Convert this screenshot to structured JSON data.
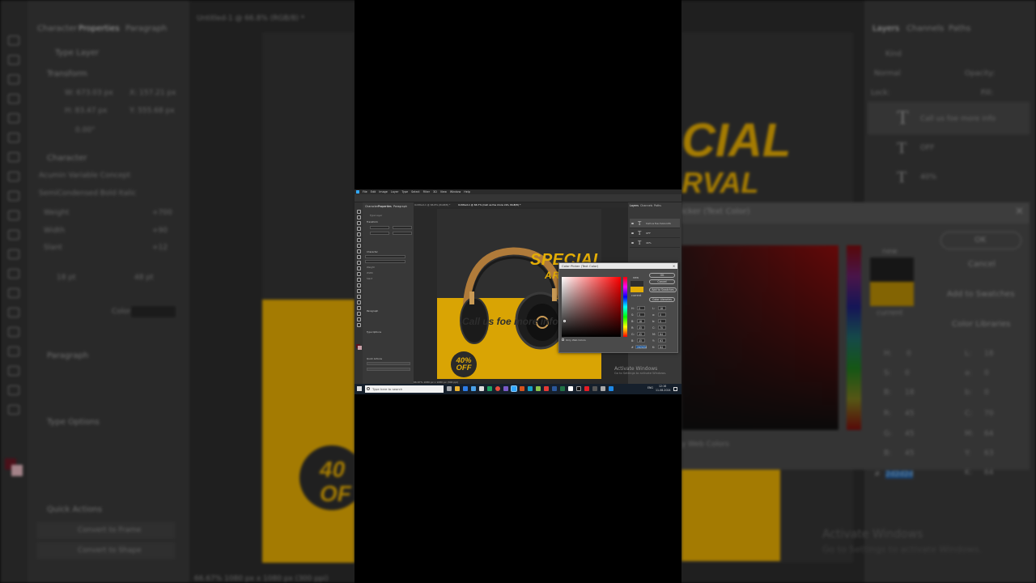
{
  "app": {
    "doc_title": "Untitled-1 @ 66.8% (RGB/8) *",
    "doc_tab2": "Untitled-1 @ 66.7% (Call us foe more info, RGB/8) *",
    "doc_tab1": "Untitled-1 @ 66.8% (RGB/8) *",
    "menu": [
      "File",
      "Edit",
      "Image",
      "Layer",
      "Type",
      "Select",
      "Filter",
      "3D",
      "View",
      "Window",
      "Help"
    ],
    "status": "66.67%   1080 px x 1080 px (300 ppi)"
  },
  "left_panel": {
    "tabs": [
      "Character",
      "Properties",
      "Paragraph"
    ],
    "type_layer": "Type Layer",
    "transform_header": "Transform",
    "w": "W: 673.03 px",
    "h": "H: 83.47 px",
    "x": "X: 157.21 px",
    "y": "Y: 555.68 px",
    "angle": "0.00°",
    "character_header": "Character",
    "font_family": "Acumin Variable Concept",
    "font_style": "SemiCondensed Bold Italic",
    "weight_label": "Weight",
    "weight_value": "+700",
    "width_label": "Width",
    "width_value": "+90",
    "slant_label": "Slant",
    "slant_value": "+12",
    "font_size": "18 pt",
    "leading": "48 pt",
    "color_label": "Color",
    "paragraph_header": "Paragraph",
    "type_options_header": "Type Options",
    "quick_actions_header": "Quick Actions",
    "convert_frame": "Convert to Frame",
    "convert_shape": "Convert to Shape"
  },
  "right_panel": {
    "tabs": [
      "Layers",
      "Channels",
      "Paths"
    ],
    "kind": "Kind",
    "blend": "Normal",
    "opacity_label": "Opacity:",
    "lock_label": "Lock:",
    "fill_label": "Fill:",
    "layers": [
      {
        "name": "Call us foe more info"
      },
      {
        "name": "OFF"
      },
      {
        "name": "40%"
      }
    ]
  },
  "poster": {
    "special": "SPECIAL",
    "arrival": "ARRIVAL",
    "callus": "Call us foe more info",
    "badge_pct": "40%",
    "badge_off": "OFF",
    "brand_colors": {
      "yellow": "#d9a404",
      "dark": "#2d2d2d"
    }
  },
  "color_picker": {
    "title": "Color Picker (Text Color)",
    "ok": "OK",
    "cancel": "Cancel",
    "add_swatches": "Add to Swatches",
    "color_libraries": "Color Libraries",
    "new_label": "new",
    "current_label": "current",
    "only_web": "Only Web Colors",
    "H": "0",
    "S": "0",
    "B": "18",
    "R": "45",
    "G": "45",
    "Bl": "45",
    "L": "18",
    "a": "0",
    "b": "0",
    "C": "70",
    "M": "64",
    "Y": "63",
    "K": "64",
    "hex": "2d2d2d",
    "new_color": "#2d2d2d",
    "current_color": "#e3ad06"
  },
  "taskbar": {
    "search_placeholder": "Type here to search",
    "lang": "ENG",
    "time": "12:16",
    "date": "11-08-2024"
  },
  "watermark": {
    "line1": "Activate Windows",
    "line2": "Go to Settings to activate Windows."
  }
}
